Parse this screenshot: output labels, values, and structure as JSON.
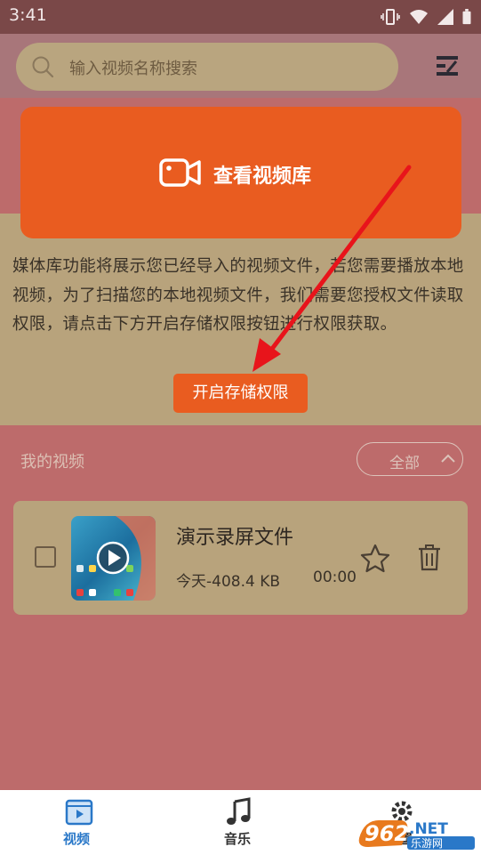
{
  "status_bar": {
    "time": "3:41"
  },
  "search": {
    "placeholder": "输入视频名称搜索"
  },
  "library_button": {
    "label": "查看视频库"
  },
  "notice": {
    "text": "媒体库功能将展示您已经导入的视频文件，若您需要播放本地视频，为了扫描您的本地视频文件，我们需要您授权文件读取权限，请点击下方开启存储权限按钮进行权限获取。",
    "button_label": "开启存储权限"
  },
  "my_videos": {
    "heading": "我的视频",
    "filter_label": "全部",
    "items": [
      {
        "title": "演示录屏文件",
        "meta": "今天-408.4 KB",
        "duration": "00:00"
      }
    ]
  },
  "bottom_nav": [
    {
      "label": "视频",
      "icon": "video-icon",
      "active": true
    },
    {
      "label": "音乐",
      "icon": "music-note-icon",
      "active": false
    },
    {
      "label": "设置",
      "icon": "gear-icon",
      "active": false
    }
  ],
  "watermark": {
    "text": "962.NET 乐游网"
  },
  "colors": {
    "accent": "#e95c20",
    "background": "#bd6b6b",
    "panel": "#b8a37c",
    "nav_active": "#2a78c8"
  }
}
